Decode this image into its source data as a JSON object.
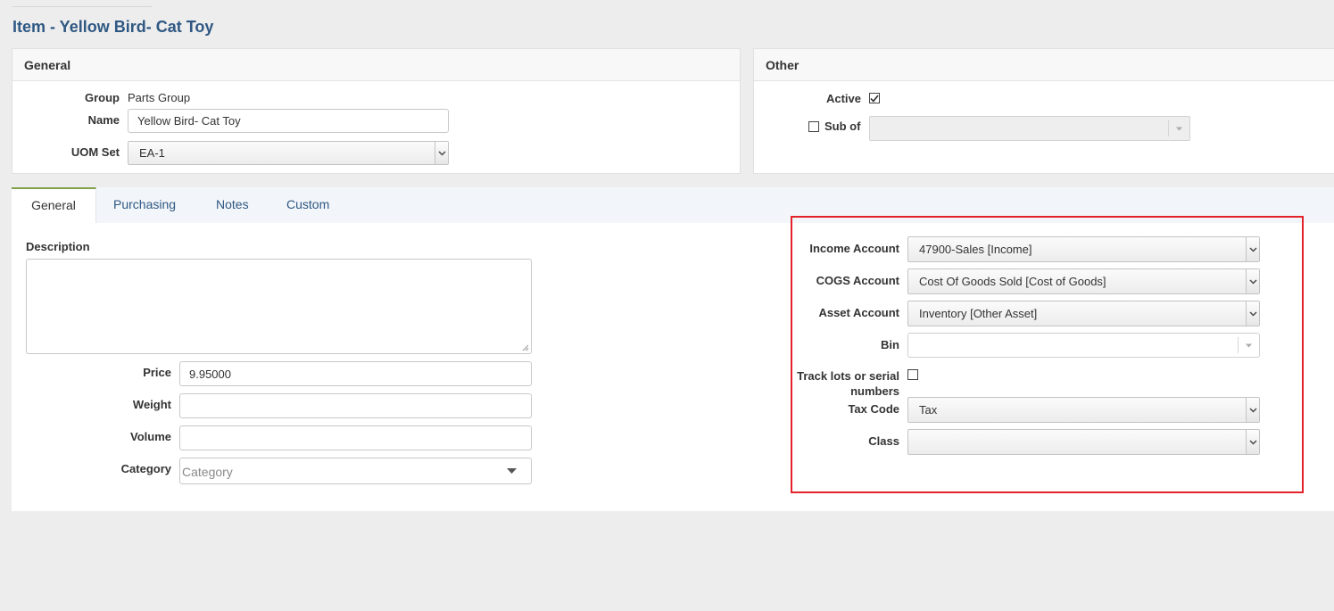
{
  "page": {
    "title": "Item - Yellow Bird- Cat Toy"
  },
  "general_panel": {
    "heading": "General",
    "group_label": "Group",
    "group_value": "Parts Group",
    "name_label": "Name",
    "name_value": "Yellow Bird- Cat Toy",
    "uom_label": "UOM Set",
    "uom_value": "EA-1"
  },
  "other_panel": {
    "heading": "Other",
    "active_label": "Active",
    "active_checked": true,
    "subof_label": "Sub of",
    "subof_checked": false,
    "subof_value": ""
  },
  "tabs": [
    {
      "label": "General",
      "active": true
    },
    {
      "label": "Purchasing",
      "active": false
    },
    {
      "label": "Notes",
      "active": false
    },
    {
      "label": "Custom",
      "active": false
    }
  ],
  "general_tab": {
    "description_label": "Description",
    "description_value": "",
    "price_label": "Price",
    "price_value": "9.95000",
    "weight_label": "Weight",
    "weight_value": "",
    "volume_label": "Volume",
    "volume_value": "",
    "category_label": "Category",
    "category_placeholder": "Category",
    "accounts": {
      "income_label": "Income Account",
      "income_value": "47900-Sales [Income]",
      "cogs_label": "COGS Account",
      "cogs_value": "Cost Of Goods Sold [Cost of Goods]",
      "asset_label": "Asset Account",
      "asset_value": "Inventory [Other Asset]",
      "bin_label": "Bin",
      "bin_value": "",
      "track_label_line1": "Track lots or serial",
      "track_label_line2": "numbers",
      "track_checked": false,
      "taxcode_label": "Tax Code",
      "taxcode_value": "Tax",
      "class_label": "Class",
      "class_value": ""
    }
  },
  "colors": {
    "title": "#2f5883",
    "tab_link": "#2f5883",
    "active_tab_accent": "#7fa24a",
    "highlight_box": "#e3222b",
    "background": "#ededed"
  }
}
